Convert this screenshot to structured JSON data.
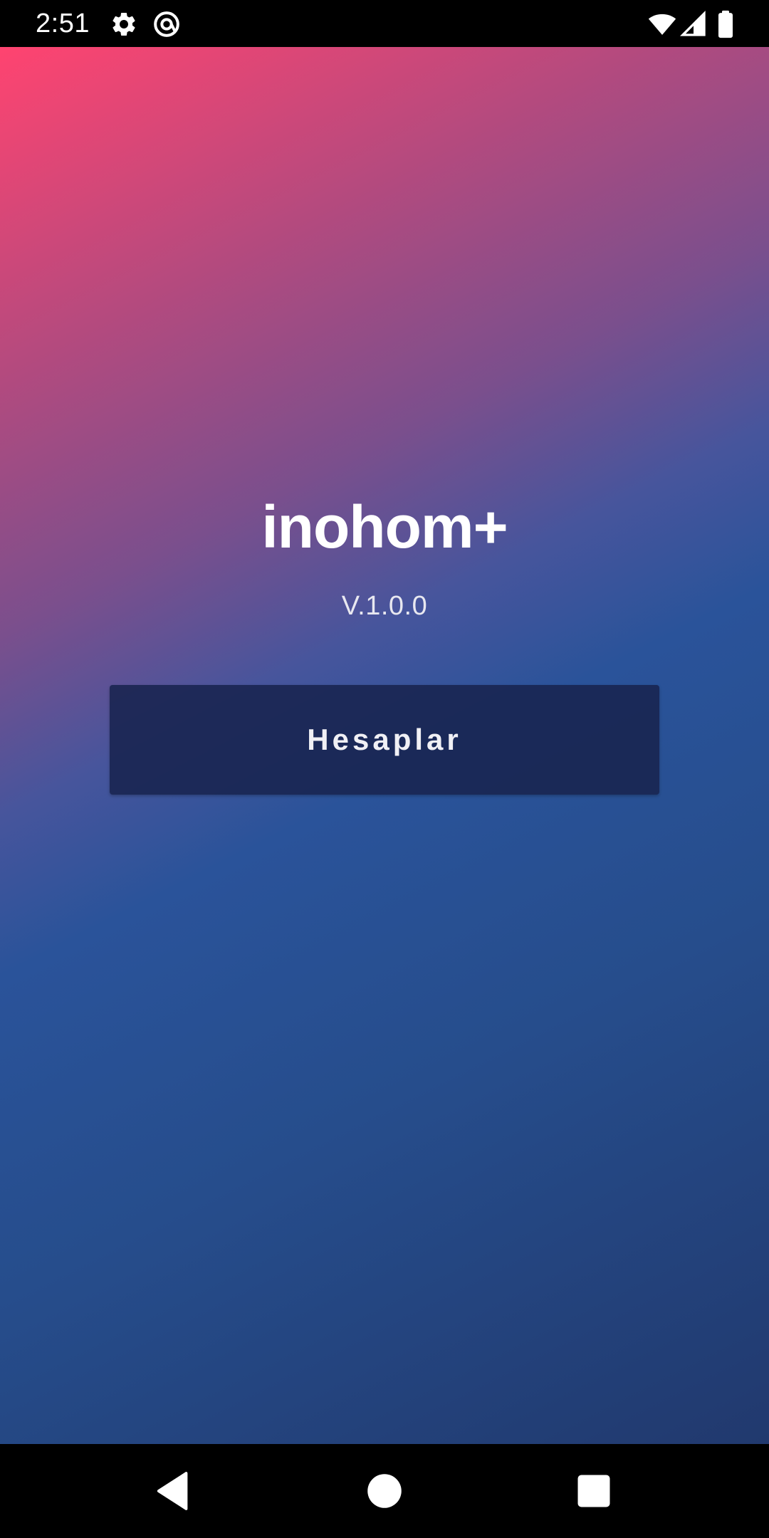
{
  "status_bar": {
    "time": "2:51",
    "left_icons": [
      "gear-icon",
      "at-sign-icon"
    ],
    "right_icons": [
      "wifi-icon",
      "cell-signal-icon",
      "battery-icon"
    ]
  },
  "app": {
    "title": "inohom+",
    "version": "V.1.0.0",
    "accounts_button_label": "Hesaplar",
    "gradient_colors": [
      "#ff4470",
      "#7a4f8d",
      "#2a539a",
      "#21396e"
    ],
    "button_color": "#18234e"
  },
  "nav_bar": {
    "buttons": [
      "back-icon",
      "home-icon",
      "recents-icon"
    ]
  }
}
